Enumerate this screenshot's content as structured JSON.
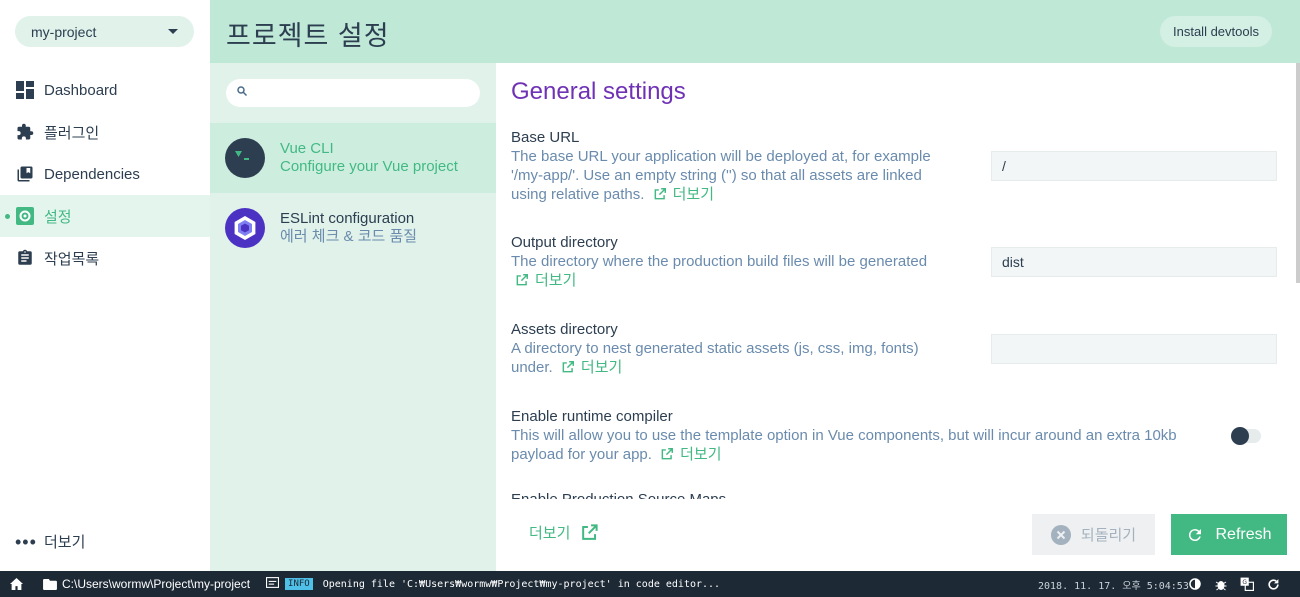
{
  "project_selector": {
    "value": "my-project"
  },
  "nav": {
    "items": [
      {
        "label": "Dashboard",
        "icon": "dashboard-icon"
      },
      {
        "label": "플러그인",
        "icon": "extension-icon"
      },
      {
        "label": "Dependencies",
        "icon": "library-icon"
      },
      {
        "label": "설정",
        "icon": "settings-icon"
      },
      {
        "label": "작업목록",
        "icon": "assignment-icon"
      }
    ],
    "more_label": "더보기"
  },
  "header": {
    "title": "프로젝트 설정",
    "devtools_label": "Install devtools"
  },
  "config_list": {
    "search_placeholder": "",
    "items": [
      {
        "title": "Vue CLI",
        "subtitle": "Configure your Vue project"
      },
      {
        "title": "ESLint configuration",
        "subtitle": "에러 체크 & 코드 품질"
      }
    ]
  },
  "content": {
    "title": "General settings",
    "settings": [
      {
        "label": "Base URL",
        "description": "The base URL your application will be deployed at, for example '/my-app/'. Use an empty string ('') so that all assets are linked using relative paths.",
        "link": "더보기",
        "value": "/"
      },
      {
        "label": "Output directory",
        "description": "The directory where the production build files will be generated",
        "link": "더보기",
        "value": "dist"
      },
      {
        "label": "Assets directory",
        "description": "A directory to nest generated static assets (js, css, img, fonts) under.",
        "link": "더보기",
        "value": ""
      },
      {
        "label": "Enable runtime compiler",
        "description": "This will allow you to use the template option in Vue components, but will incur around an extra 10kb payload for your app.",
        "link": "더보기",
        "toggle": false
      }
    ],
    "cut_off_label": "Enable Production Source Maps"
  },
  "actions": {
    "more_label": "더보기",
    "revert_label": "되돌리기",
    "refresh_label": "Refresh"
  },
  "statusbar": {
    "path": "C:\\Users\\wormw\\Project\\my-project",
    "level": "INFO",
    "message": "Opening file 'C:₩Users₩wormw₩Project₩my-project' in code editor...",
    "time": "2018. 11. 17. 오후 5:04:53"
  },
  "colors": {
    "accent": "#42b983",
    "header_bg": "#bfe8d7",
    "title_purple": "#6f32b5",
    "statusbar_bg": "#1d2935"
  }
}
